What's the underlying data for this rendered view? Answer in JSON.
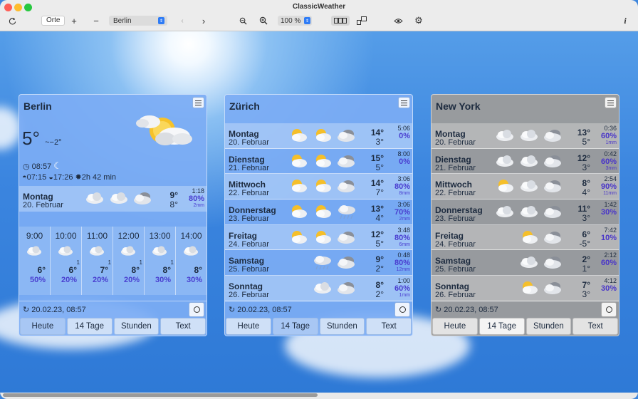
{
  "app_title": "ClassicWeather",
  "toolbar": {
    "places_label": "Orte",
    "plus": "+",
    "minus": "−",
    "city": "Berlin",
    "zoom": "100 %"
  },
  "panels": [
    {
      "city": "Berlin",
      "mode": "today",
      "now_temp": "5°",
      "feels_like": "~−2°",
      "time": "08:57",
      "sunrise": "07:15",
      "sunset": "17:26",
      "daylight": "2h 42 min",
      "today": {
        "day": "Montag",
        "date": "20. Februar",
        "hi": "9°",
        "lo": "8°",
        "time": "1:18",
        "pct": "80%",
        "mm": "2mm"
      },
      "hours": [
        {
          "time": "9:00",
          "temp": "6°",
          "sup": "",
          "pct": "50%"
        },
        {
          "time": "10:00",
          "temp": "6°",
          "sup": "1",
          "pct": "20%"
        },
        {
          "time": "11:00",
          "temp": "7°",
          "sup": "1",
          "pct": "20%"
        },
        {
          "time": "12:00",
          "temp": "8°",
          "sup": "1",
          "pct": "20%"
        },
        {
          "time": "13:00",
          "temp": "8°",
          "sup": "1",
          "pct": "30%"
        },
        {
          "time": "14:00",
          "temp": "8°",
          "sup": "",
          "pct": "30%"
        }
      ],
      "updated": "20.02.23, 08:57",
      "tabs": [
        "Heute",
        "14 Tage",
        "Stunden",
        "Text"
      ],
      "active_tab": 0
    },
    {
      "city": "Zürich",
      "mode": "days",
      "days": [
        {
          "day": "Montag",
          "date": "20. Februar",
          "hi": "14°",
          "lo": "3°",
          "time": "5:06",
          "pct": "0%",
          "mm": ""
        },
        {
          "day": "Dienstag",
          "date": "21. Februar",
          "hi": "15°",
          "lo": "5°",
          "time": "8:00",
          "pct": "0%",
          "mm": ""
        },
        {
          "day": "Mittwoch",
          "date": "22. Februar",
          "hi": "14°",
          "lo": "7°",
          "time": "3:06",
          "pct": "80%",
          "mm": "8mm"
        },
        {
          "day": "Donnerstag",
          "date": "23. Februar",
          "hi": "13°",
          "lo": "4°",
          "time": "3:06",
          "pct": "70%",
          "mm": "2mm"
        },
        {
          "day": "Freitag",
          "date": "24. Februar",
          "hi": "12°",
          "lo": "5°",
          "time": "3:48",
          "pct": "80%",
          "mm": "6mm"
        },
        {
          "day": "Samstag",
          "date": "25. Februar",
          "hi": "9°",
          "lo": "2°",
          "time": "0:48",
          "pct": "80%",
          "mm": "12mm"
        },
        {
          "day": "Sonntag",
          "date": "26. Februar",
          "hi": "8°",
          "lo": "2°",
          "time": "1:00",
          "pct": "60%",
          "mm": "1mm"
        }
      ],
      "updated": "20.02.23, 08:57",
      "tabs": [
        "Heute",
        "14 Tage",
        "Stunden",
        "Text"
      ],
      "active_tab": 1
    },
    {
      "city": "New York",
      "mode": "days",
      "days": [
        {
          "day": "Montag",
          "date": "20. Februar",
          "hi": "13°",
          "lo": "5°",
          "time": "0:36",
          "pct": "60%",
          "mm": "1mm"
        },
        {
          "day": "Dienstag",
          "date": "21. Februar",
          "hi": "12°",
          "lo": "3°",
          "time": "0:42",
          "pct": "60%",
          "mm": "3mm"
        },
        {
          "day": "Mittwoch",
          "date": "22. Februar",
          "hi": "8°",
          "lo": "4°",
          "time": "2:54",
          "pct": "90%",
          "mm": "11mm"
        },
        {
          "day": "Donnerstag",
          "date": "23. Februar",
          "hi": "11°",
          "lo": "3°",
          "time": "1:42",
          "pct": "30%",
          "mm": ""
        },
        {
          "day": "Freitag",
          "date": "24. Februar",
          "hi": "6°",
          "lo": "-5°",
          "time": "7:42",
          "pct": "10%",
          "mm": ""
        },
        {
          "day": "Samstag",
          "date": "25. Februar",
          "hi": "2°",
          "lo": "1°",
          "time": "2:12",
          "pct": "60%",
          "mm": ""
        },
        {
          "day": "Sonntag",
          "date": "26. Februar",
          "hi": "7°",
          "lo": "3°",
          "time": "4:12",
          "pct": "30%",
          "mm": ""
        }
      ],
      "updated": "20.02.23, 08:57",
      "tabs": [
        "Heute",
        "14 Tage",
        "Stunden",
        "Text"
      ],
      "active_tab": 1
    }
  ]
}
